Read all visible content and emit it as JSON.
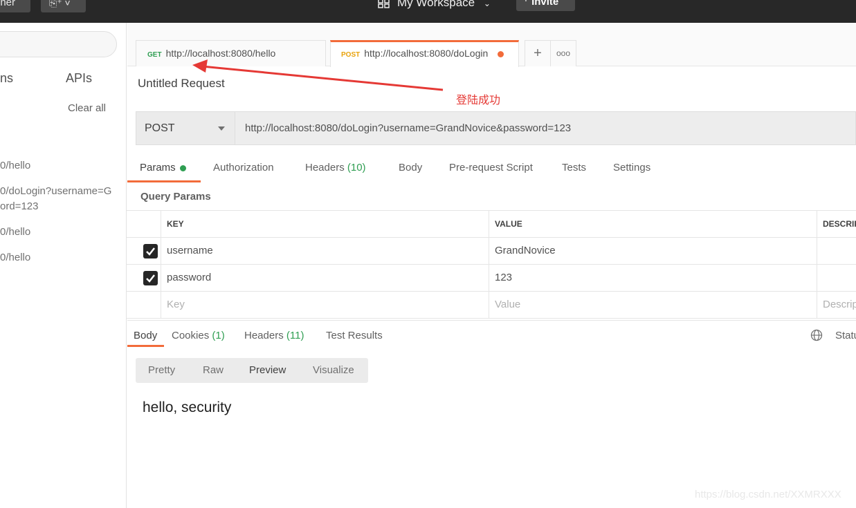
{
  "topbar": {
    "runner_label": "nner",
    "new_label": "⎘⁺ ˅",
    "workspace_label": "My Workspace",
    "invite_label": "Invite"
  },
  "sidebar": {
    "tab_collections": "ns",
    "tab_apis": "APIs",
    "clear_all": "Clear all",
    "history": [
      "0/hello",
      "0/doLogin?username=G",
      "ord=123",
      "0/hello",
      "0/hello"
    ]
  },
  "request_tabs": [
    {
      "method": "GET",
      "url": "http://localhost:8080/hello"
    },
    {
      "method": "POST",
      "url": "http://localhost:8080/doLogin"
    }
  ],
  "request": {
    "title": "Untitled Request",
    "annotation": "登陆成功",
    "method": "POST",
    "url": "http://localhost:8080/doLogin?username=GrandNovice&password=123"
  },
  "request_subtabs": {
    "params": "Params",
    "authorization": "Authorization",
    "headers": "Headers",
    "headers_count": "(10)",
    "body": "Body",
    "prerequest": "Pre-request Script",
    "tests": "Tests",
    "settings": "Settings"
  },
  "query_params": {
    "title": "Query Params",
    "columns": [
      "KEY",
      "VALUE",
      "DESCRIPTION"
    ],
    "rows": [
      {
        "key": "username",
        "value": "GrandNovice",
        "checked": true
      },
      {
        "key": "password",
        "value": "123",
        "checked": true
      }
    ],
    "placeholders": {
      "key": "Key",
      "value": "Value",
      "description": "Description"
    }
  },
  "response": {
    "tabs": {
      "body": "Body",
      "cookies": "Cookies",
      "cookies_count": "(1)",
      "headers": "Headers",
      "headers_count": "(11)",
      "test_results": "Test Results"
    },
    "status_label": "Status",
    "views": [
      "Pretty",
      "Raw",
      "Preview",
      "Visualize"
    ],
    "body_text": "hello, security"
  },
  "watermark": "https://blog.csdn.net/XXMRXXX",
  "colors": {
    "accent": "#f26b3a",
    "get": "#2f9e52",
    "post": "#e8a20c",
    "annotation": "#e53935"
  }
}
